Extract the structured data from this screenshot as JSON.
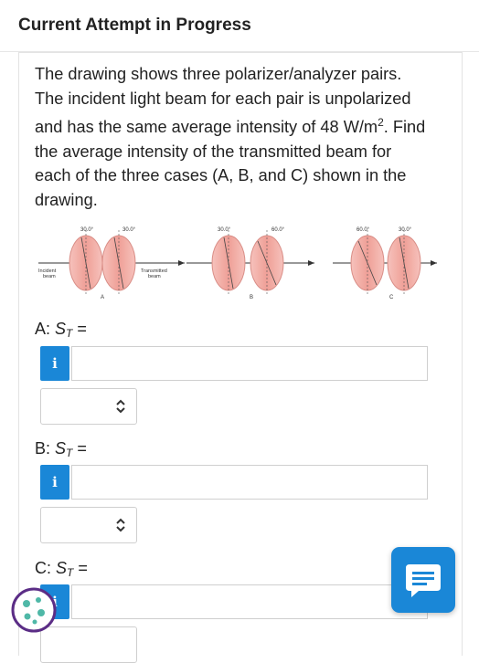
{
  "header": {
    "title": "Current Attempt in Progress"
  },
  "question": {
    "line1": "The drawing shows three polarizer/analyzer pairs.",
    "line2": "The incident light beam for each pair is unpolarized",
    "line3_pre": "and has the same average intensity of 48 W/m",
    "line3_sup": "2",
    "line3_post": ". Find",
    "line4": "the average intensity of the transmitted beam for",
    "line5": "each of the three cases (A, B, and C) shown in the",
    "line6": "drawing."
  },
  "figure": {
    "incident_label_1": "Incident",
    "incident_label_2": "beam",
    "transmitted_label_1": "Transmitted",
    "transmitted_label_2": "beam",
    "pairs": [
      {
        "label": "A",
        "angle1": "30.0°",
        "angle2": "30.0°"
      },
      {
        "label": "B",
        "angle1": "30.0°",
        "angle2": "60.0°"
      },
      {
        "label": "C",
        "angle1": "60.0°",
        "angle2": "30.0°"
      }
    ]
  },
  "parts": [
    {
      "prefix": "A: ",
      "symbol": "S",
      "subscript": "T",
      "suffix": " =",
      "info": "i"
    },
    {
      "prefix": "B: ",
      "symbol": "S",
      "subscript": "T",
      "suffix": " =",
      "info": "i"
    },
    {
      "prefix": "C: ",
      "symbol": "S",
      "subscript": "T",
      "suffix": " =",
      "info": "i"
    }
  ],
  "icons": {
    "chat": "chat-icon",
    "cookie": "cookie-icon",
    "select_chevron": "chevron-up-down-icon"
  },
  "colors": {
    "accent": "#1a87d7",
    "disk": "#f2a7a0"
  }
}
